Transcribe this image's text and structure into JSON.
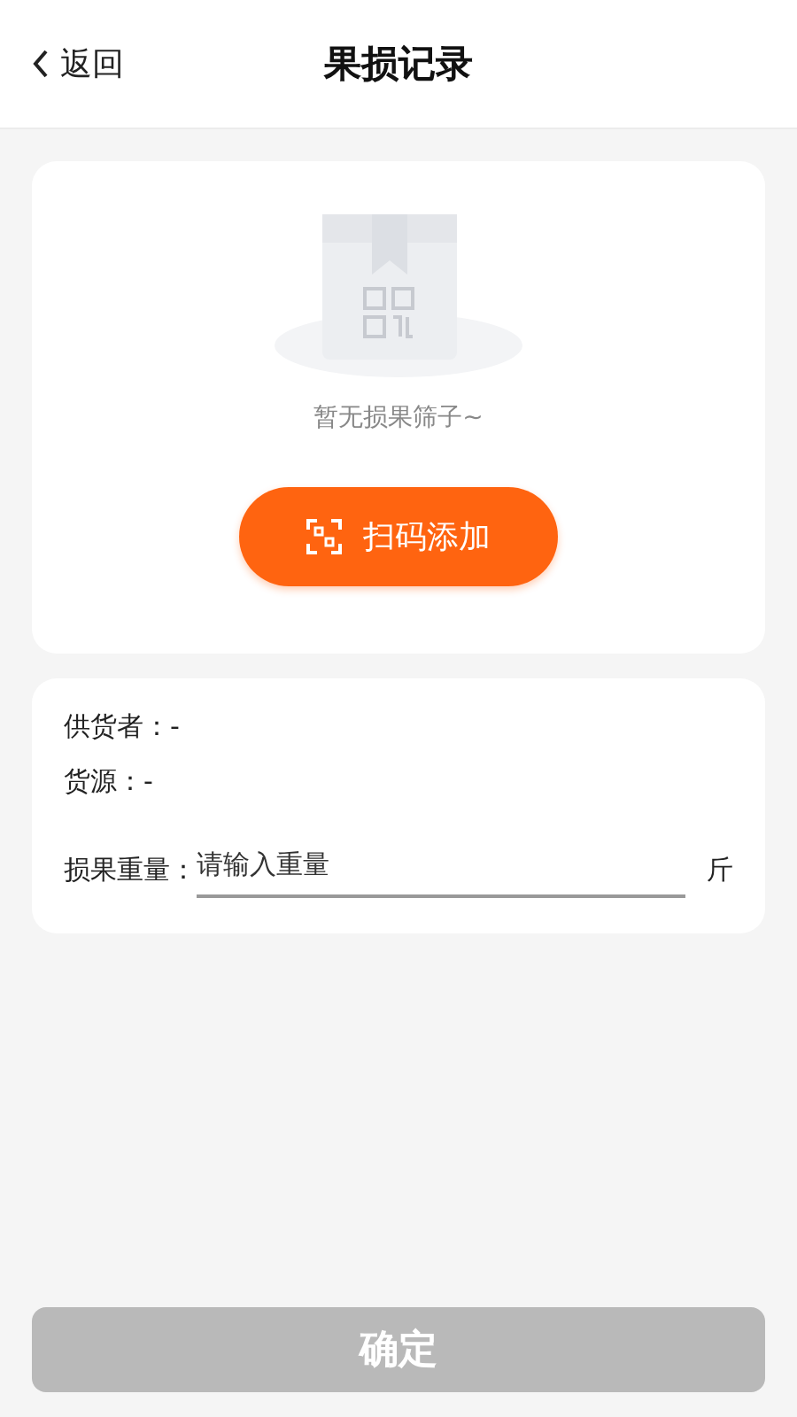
{
  "header": {
    "back": "返回",
    "title": "果损记录"
  },
  "empty": {
    "message": "暂无损果筛子~",
    "scan_button": "扫码添加"
  },
  "info": {
    "rows": [
      "供货者：-",
      "货源：-"
    ],
    "weight": {
      "label": "损果重量：",
      "placeholder": "请输入重量",
      "unit": "斤"
    }
  },
  "confirm": {
    "label": "确定",
    "disabled": true
  }
}
